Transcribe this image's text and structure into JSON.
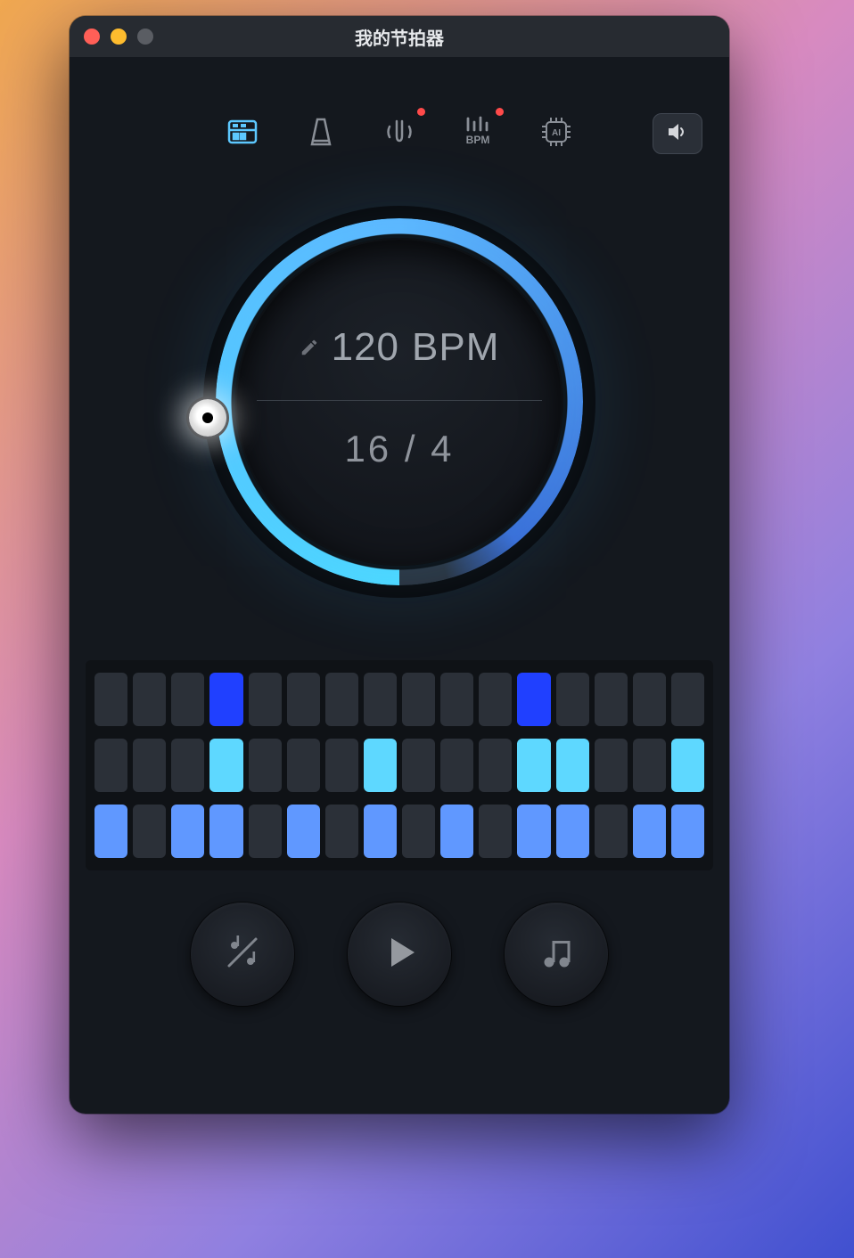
{
  "window": {
    "title": "我的节拍器"
  },
  "colors": {
    "accent": "#5dc8ff",
    "inactive": "#7a7f87",
    "cell_off": "#2b3038",
    "cell_row1_on": "#2040ff",
    "cell_row2_on": "#5ed8ff",
    "cell_row3_on": "#6098ff"
  },
  "toolbar": {
    "tabs": [
      {
        "name": "drum-machine",
        "active": true,
        "badge": false
      },
      {
        "name": "metronome",
        "active": false,
        "badge": false
      },
      {
        "name": "tuner",
        "active": false,
        "badge": true
      },
      {
        "name": "bpm-detector",
        "active": false,
        "badge": true
      },
      {
        "name": "ai",
        "active": false,
        "badge": false
      }
    ],
    "bpm_tab_label": "BPM",
    "ai_tab_label": "AI",
    "speaker": "speaker-icon"
  },
  "dial": {
    "bpm_value": "120",
    "bpm_unit": "BPM",
    "time_signature": "16 / 4",
    "knob_angle_deg": 270
  },
  "grid": {
    "rows": [
      {
        "cells": [
          0,
          0,
          0,
          1,
          0,
          0,
          0,
          0,
          0,
          0,
          0,
          1,
          0,
          0,
          0,
          0
        ]
      },
      {
        "cells": [
          0,
          0,
          0,
          1,
          0,
          0,
          0,
          1,
          0,
          0,
          0,
          1,
          1,
          0,
          0,
          1
        ]
      },
      {
        "cells": [
          1,
          0,
          1,
          1,
          0,
          1,
          0,
          1,
          0,
          1,
          0,
          1,
          1,
          0,
          1,
          1
        ]
      }
    ]
  },
  "controls": {
    "subdivide": "subdivide-icon",
    "play": "play-icon",
    "sound": "sound-icon"
  }
}
